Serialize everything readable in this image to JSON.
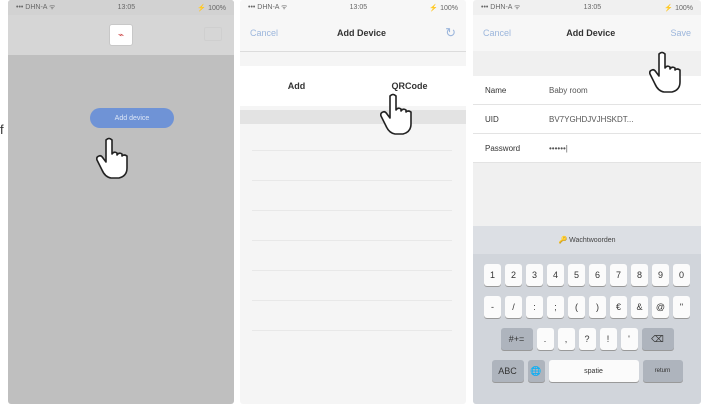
{
  "side_letter": "f",
  "phone1": {
    "status_left": "••• DHN-A ᯤ",
    "status_center": "13:05",
    "status_right": "⚡ 100%",
    "app_icon_glyph": "⌁",
    "pill_label": "Add device"
  },
  "phone2": {
    "status_left": "••• DHN-A ᯤ",
    "status_center": "13:05",
    "status_right": "⚡ 100%",
    "cancel": "Cancel",
    "title": "Add Device",
    "refresh_glyph": "↻",
    "tab_add": "Add",
    "tab_qrcode": "QRCode"
  },
  "phone3": {
    "status_left": "••• DHN-A ᯤ",
    "status_center": "13:05",
    "status_right": "⚡ 100%",
    "cancel": "Cancel",
    "title": "Add Device",
    "save": "Save",
    "form": [
      {
        "label": "Name",
        "value": "Baby room"
      },
      {
        "label": "UID",
        "value": "BV7YGHDJVJHSKDT..."
      },
      {
        "label": "Password",
        "value": "••••••|"
      }
    ],
    "keyboard": {
      "suggestion": "Wachtwoorden",
      "row1": [
        "1",
        "2",
        "3",
        "4",
        "5",
        "6",
        "7",
        "8",
        "9",
        "0"
      ],
      "row2": [
        "-",
        "/",
        ":",
        ";",
        "(",
        ")",
        "€",
        "&",
        "@",
        "\""
      ],
      "row3": [
        ".",
        ",",
        "?",
        "!",
        "'"
      ],
      "row3_left": "#+=",
      "row3_right": "⌫",
      "row4_left": "ABC",
      "row4_globe": "🌐",
      "row4_space": "spatie",
      "row4_return": "return"
    }
  }
}
